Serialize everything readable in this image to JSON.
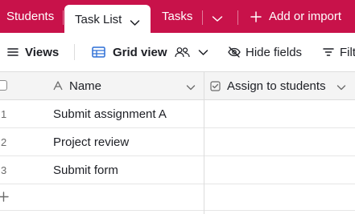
{
  "tabs": {
    "students": "Students",
    "task_list": "Task List",
    "tasks": "Tasks",
    "add_or_import": "Add or import"
  },
  "toolbar": {
    "views": "Views",
    "grid_view": "Grid view",
    "hide_fields": "Hide fields",
    "filter": "Filt"
  },
  "grid": {
    "columns": [
      "Name",
      "Assign to students"
    ],
    "rows": [
      {
        "num": "1",
        "name": "Submit assignment A",
        "assign": ""
      },
      {
        "num": "2",
        "name": "Project review",
        "assign": ""
      },
      {
        "num": "3",
        "name": "Submit form",
        "assign": ""
      }
    ]
  },
  "colors": {
    "brand": "#c8124a",
    "header_bg": "#f4f4f4",
    "border": "#dcdcdc"
  },
  "icons": [
    "chevron-down-icon",
    "plus-icon",
    "list-icon",
    "grid-icon",
    "people-icon",
    "eye-off-icon",
    "filter-icon",
    "text-field-icon",
    "checkbox-field-icon"
  ]
}
